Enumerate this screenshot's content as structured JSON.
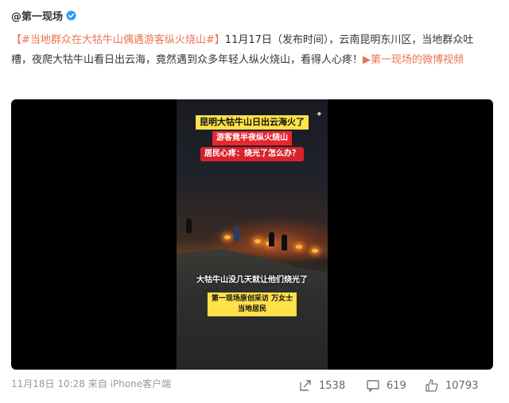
{
  "author": {
    "name": "@第一现场",
    "verified_icon": "verified-badge-icon"
  },
  "post": {
    "hashtag": "【#当地群众在大牯牛山偶遇游客纵火烧山#】",
    "body": "11月17日（发布时间），云南昆明东川区，当地群众吐槽，夜爬大牯牛山看日出云海，竟然遇到众多年轻人纵火烧山，看得人心疼！",
    "video_link": "第一现场的微博视频"
  },
  "video": {
    "caption_top": "昆明大牯牛山日出云海火了",
    "caption_red": "游客竟半夜纵火烧山",
    "caption_question": "居民心疼：烧光了怎么办？",
    "subtitle": "大牯牛山没几天就让他们烧光了",
    "interview_line1": "第一现场原创采访 万女士",
    "interview_line2": "当地居民"
  },
  "footer": {
    "time_source": "11月18日 10:28 来自 iPhone客户端",
    "repost_count": "1538",
    "comment_count": "619",
    "like_count": "10793"
  },
  "colors": {
    "link": "#eb7350",
    "text": "#333333",
    "muted": "#999999"
  }
}
